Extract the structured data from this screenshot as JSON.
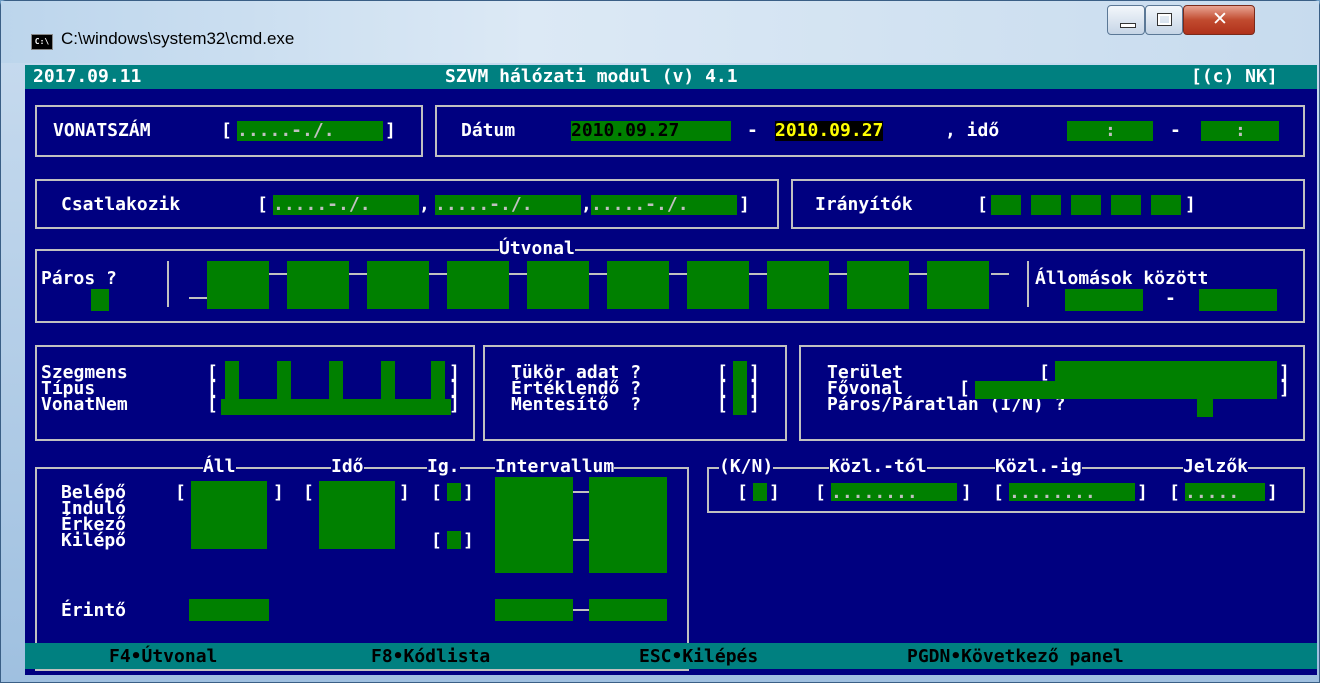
{
  "window": {
    "title": "C:\\windows\\system32\\cmd.exe",
    "icon_label": "C:\\"
  },
  "header": {
    "date": "2017.09.11",
    "app_title": "SZVM hálózati modul (v) 4.1",
    "copyright": "[(c) NK]"
  },
  "train": {
    "label": "VONATSZÁM",
    "field_mask": ".....-./."
  },
  "datum": {
    "label": "Dátum",
    "from": "2010.09.27",
    "to": "2010.09.27",
    "ido_label": ", idő",
    "dash": "-",
    "time_mask": ":"
  },
  "csatlakozik": {
    "label": "Csatlakozik",
    "fields": [
      ".....-./.",
      ".....-./.",
      ".....-./."
    ]
  },
  "iranyitok": {
    "label": "Irányítók"
  },
  "utvonal": {
    "title": "Útvonal",
    "paros_label": "Páros ?",
    "allomasok_label": "Állomások között",
    "dash": "-"
  },
  "szegmens": {
    "rows": [
      "Szegmens",
      "Típus",
      "VonatNem"
    ]
  },
  "tukor": {
    "rows": [
      "Tükör adat ?",
      "Értéklendő ?",
      "Mentesítő  ?"
    ]
  },
  "terulet": {
    "rows": [
      "Terület",
      "Fővonal",
      "Páros/Páratlan (I/N) ?"
    ]
  },
  "times": {
    "headers": [
      "Áll",
      "Idő",
      "Ig.",
      "Intervallum"
    ],
    "rows": [
      "Belépő",
      "Induló",
      "Érkező",
      "Kilépő"
    ],
    "erinto_label": "Érintő",
    "all_mask": ".....",
    "ido_mask": "..:..",
    "colon": ":"
  },
  "kozl": {
    "headers": [
      "(K/N)",
      "Közl.-tól",
      "Közl.-ig",
      "Jelzők"
    ],
    "date_mask": "........",
    "jelzo_mask": "....."
  },
  "footer": {
    "keys": [
      "F4•Útvonal",
      "F8•Kódlista",
      "ESC•Kilépés",
      "PGDN•Következő panel"
    ]
  },
  "colors": {
    "console_bg": "#000080",
    "field_green": "#008000",
    "bar_teal": "#008080",
    "highlight_yellow": "#ffff00",
    "text_white": "#ffffff",
    "frame_gray": "#c0c0c0"
  }
}
